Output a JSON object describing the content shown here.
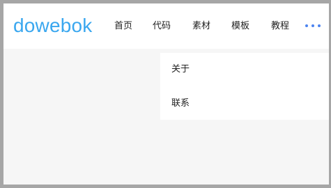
{
  "brand": {
    "logo_text": "dowebok",
    "logo_color": "#3aa7ef"
  },
  "nav": {
    "items": [
      {
        "label": "首页"
      },
      {
        "label": "代码"
      },
      {
        "label": "素材"
      },
      {
        "label": "模板"
      },
      {
        "label": "教程"
      }
    ],
    "more_icon": "more-dots-icon",
    "accent_color": "#4c84f0"
  },
  "dropdown": {
    "items": [
      {
        "label": "关于"
      },
      {
        "label": "联系"
      }
    ]
  }
}
